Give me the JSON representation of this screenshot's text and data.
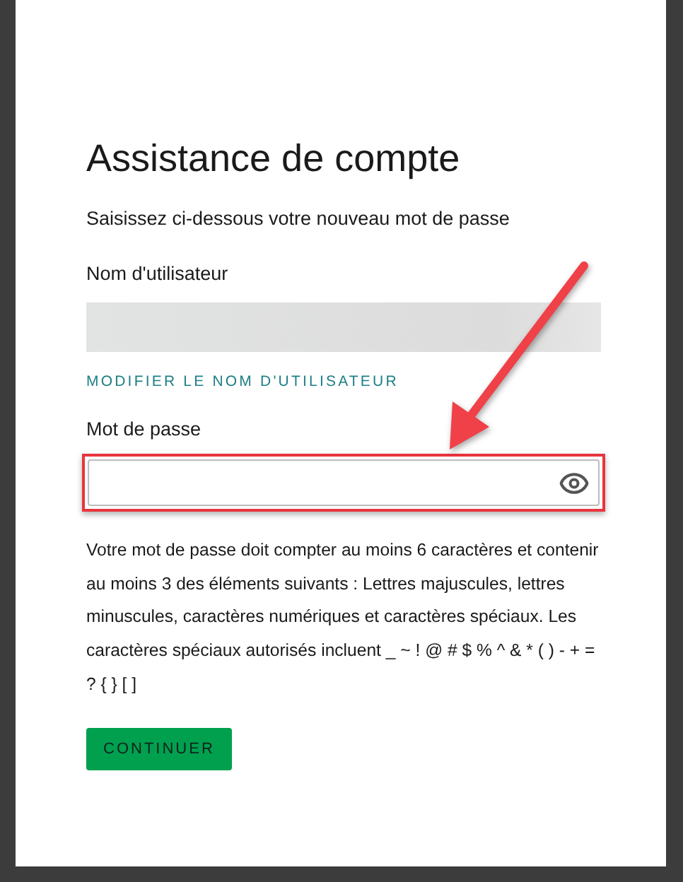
{
  "title": "Assistance de compte",
  "subtitle": "Saisissez ci-dessous votre nouveau mot de passe",
  "username": {
    "label": "Nom d'utilisateur",
    "link": "MODIFIER LE NOM D'UTILISATEUR"
  },
  "password": {
    "label": "Mot de passe",
    "highlighted": true
  },
  "requirements": "Votre mot de passe doit compter au moins 6 caractères et contenir au moins 3 des éléments suivants : Lettres majuscules, lettres minuscules, caractères numériques et caractères spéciaux. Les caractères spéciaux autorisés incluent _ ~ ! @ # $ % ^ & * ( ) - + = ? { } [ ]",
  "button": "CONTINUER"
}
